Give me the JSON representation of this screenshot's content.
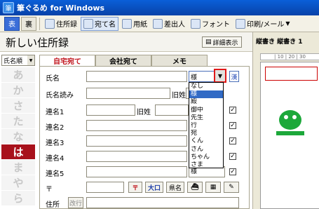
{
  "window": {
    "title": "筆ぐるめ for Windows"
  },
  "toolbar": {
    "items": [
      {
        "label": "表"
      },
      {
        "label": "裏"
      },
      {
        "label": "住所録"
      },
      {
        "label": "宛て名"
      },
      {
        "label": "用紙"
      },
      {
        "label": "差出人"
      },
      {
        "label": "フォント"
      },
      {
        "label": "印刷/メール"
      }
    ]
  },
  "page": {
    "title": "新しい住所録",
    "detail_button": "詳細表示"
  },
  "sort": {
    "value": "氏名順"
  },
  "kana_index": [
    "あ",
    "か",
    "さ",
    "た",
    "な",
    "は",
    "ま",
    "や",
    "ら"
  ],
  "kana_active": "は",
  "tabs": [
    {
      "label": "自宅宛て"
    },
    {
      "label": "会社宛て"
    },
    {
      "label": "メモ"
    }
  ],
  "form": {
    "name_label": "氏名",
    "reading_label": "氏名読み",
    "former_name_label": "旧姓",
    "rename1_label": "連名1",
    "rename1_former_label": "旧姓",
    "rename2_label": "連名2",
    "rename3_label": "連名3",
    "rename4_label": "連名4",
    "rename5_label": "連名5",
    "postal_label": "〒",
    "postal_button": "〒",
    "zip_button": "大口",
    "pref_button": "県名",
    "address_label": "住所",
    "newline_button": "改行",
    "keisho_value": "様",
    "keisho_button2": "漢",
    "rename5_keisho": "様"
  },
  "keisho_dropdown": {
    "options": [
      "なし",
      "様",
      "殿",
      "御中",
      "先生",
      "行",
      "宛",
      "くん",
      "さん",
      "ちゃん",
      "さま"
    ],
    "selected": "様"
  },
  "preview": {
    "title": "縦書き 縦書き 1",
    "ruler": "| 10 | 20 | 30"
  }
}
